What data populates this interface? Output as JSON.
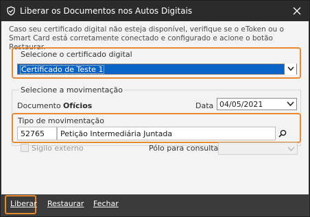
{
  "window": {
    "title": "Liberar os Documentos nos Autos Digitais",
    "accent_color": "#e8892f",
    "title_bar_color": "#2b2b2b"
  },
  "info_text": "Caso seu certificado digital não esteja disponível, verifique se o eToken ou o Smart Card está corretamente conectado e configurado e acione o botão Restaurar.",
  "certificate": {
    "group_label": "Selecione o certificado digital",
    "selected": "Certificado de Teste 1"
  },
  "movement": {
    "group_label": "Selecione a movimentação",
    "document_label": "Documento",
    "document_value": "Ofícios",
    "date_label": "Data",
    "date_value": "04/05/2021",
    "type_label": "Tipo de movimentação",
    "type_code": "52765",
    "type_description": "Petição Intermediária Juntada"
  },
  "options": {
    "sigilo_label": "Sigilo externo",
    "polo_label": "Pólo para consulta",
    "polo_value": ""
  },
  "footer": {
    "liberar": "Liberar",
    "restaurar": "Restaurar",
    "fechar": "Fechar"
  }
}
